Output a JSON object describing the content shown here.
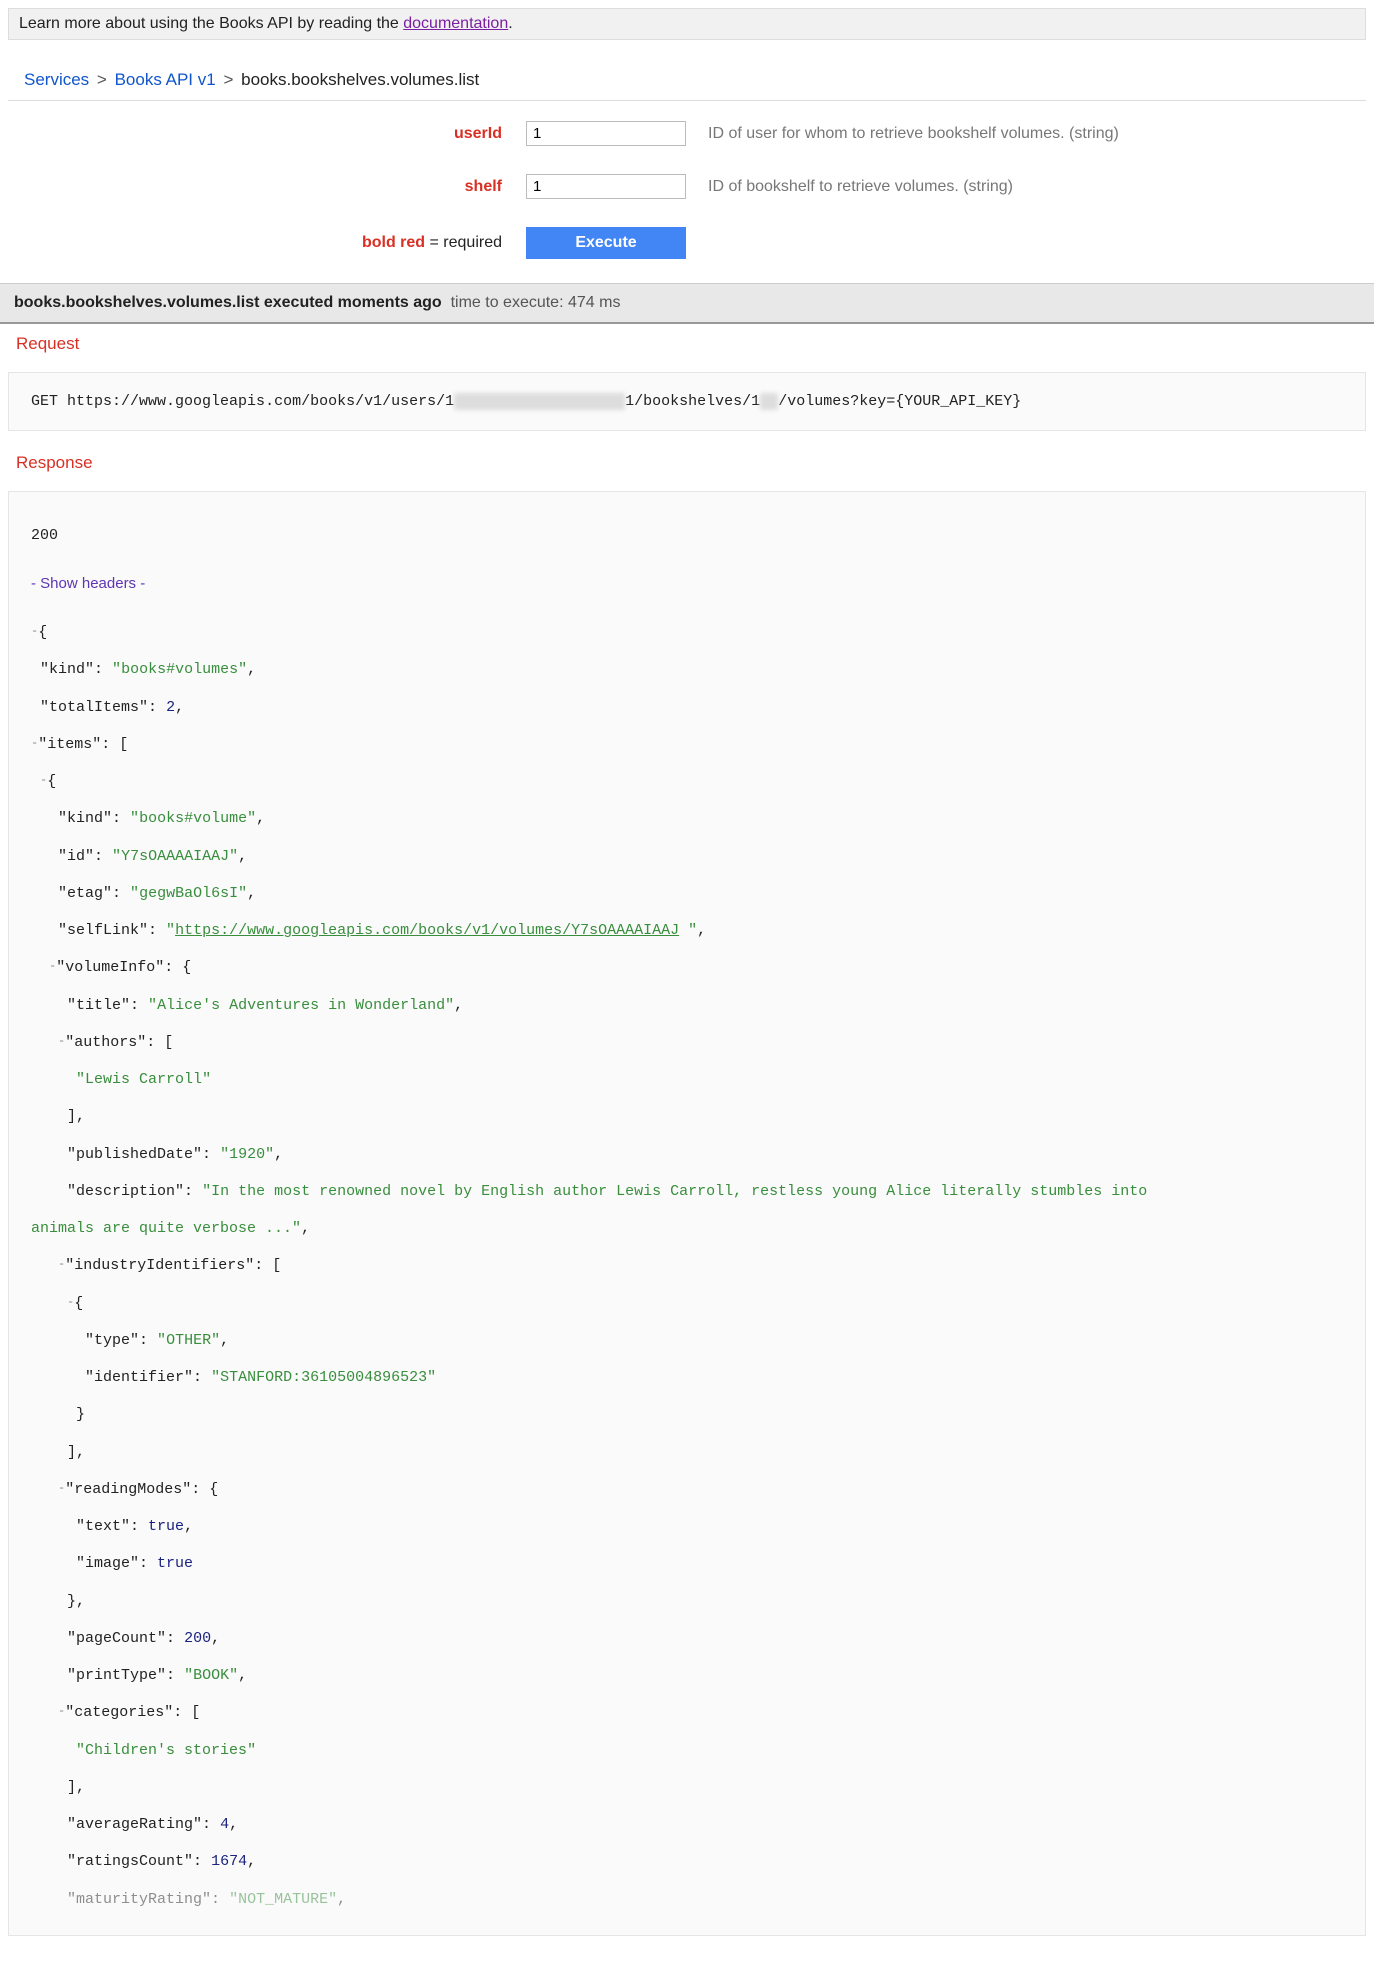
{
  "infoBar": {
    "prefix": "Learn more about using the Books API by reading the ",
    "link": "documentation",
    "suffix": "."
  },
  "breadcrumb": {
    "services": "Services",
    "api": "Books API v1",
    "method": "books.bookshelves.volumes.list"
  },
  "params": {
    "userId": {
      "label": "userId",
      "value": "1",
      "desc": "ID of user for whom to retrieve bookshelf volumes. (string)"
    },
    "shelf": {
      "label": "shelf",
      "value": "1",
      "desc": "ID of bookshelf to retrieve volumes. (string)"
    }
  },
  "legend": {
    "boldRed": "bold red",
    "required": " = required"
  },
  "executeBtn": "Execute",
  "execBar": {
    "title": "books.bookshelves.volumes.list executed moments ago",
    "timing": "time to execute: 474 ms"
  },
  "sections": {
    "request": "Request",
    "response": "Response"
  },
  "request": {
    "method": "GET",
    "url_pre": "https://www.googleapis.com/books/v1/users/1",
    "url_mid": "1/bookshelves/1",
    "url_post": "/volumes?key={YOUR_API_KEY}"
  },
  "response": {
    "status": "200",
    "showHeaders": "- Show headers -",
    "body": {
      "kind": "books#volumes",
      "totalItems": 2,
      "items": [
        {
          "kind": "books#volume",
          "id": "Y7sOAAAAIAAJ",
          "etag": "gegwBaOl6sI",
          "selfLink": "https://www.googleapis.com/books/v1/volumes/Y7sOAAAAIAAJ",
          "volumeInfo": {
            "title": "Alice's Adventures in Wonderland",
            "authors": [
              "Lewis Carroll"
            ],
            "publishedDate": "1920",
            "description": "In the most renowned novel by English author Lewis Carroll, restless young Alice literally stumbles into",
            "description_cont": "animals are quite verbose ...",
            "industryIdentifiers": [
              {
                "type": "OTHER",
                "identifier": "STANFORD:36105004896523"
              }
            ],
            "readingModes": {
              "text": true,
              "image": true
            },
            "pageCount": 200,
            "printType": "BOOK",
            "categories": [
              "Children's stories"
            ],
            "averageRating": 4,
            "ratingsCount": 1674,
            "maturityRating": "NOT_MATURE"
          }
        }
      ]
    }
  }
}
